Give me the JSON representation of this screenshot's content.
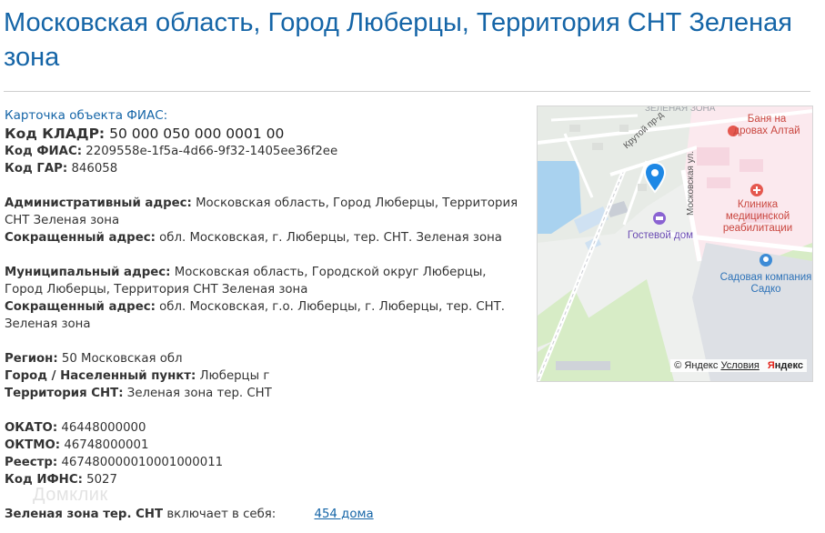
{
  "header": {
    "title": "Московская область, Город Люберцы, Территория СНТ Зеленая зона"
  },
  "card": {
    "link_text": "Карточка объекта ФИАС:",
    "kladr": {
      "label": "Код КЛАДР:",
      "value": "50 000 050 000 0001 00"
    },
    "fias": {
      "label": "Код ФИАС:",
      "value": "2209558e-1f5a-4d66-9f32-1405ee36f2ee"
    },
    "gar": {
      "label": "Код ГАР:",
      "value": "846058"
    }
  },
  "addresses": {
    "admin": {
      "label": "Административный адрес:",
      "value": "Московская область, Город Люберцы, Территория СНТ Зеленая зона"
    },
    "admin_short": {
      "label": "Сокращенный адрес:",
      "value": "обл. Московская, г. Люберцы, тер. СНТ. Зеленая зона"
    },
    "municipal": {
      "label": "Муниципальный адрес:",
      "value": "Московская область, Городской округ Люберцы, Город Люберцы, Территория СНТ Зеленая зона"
    },
    "municipal_short": {
      "label": "Сокращенный адрес:",
      "value": "обл. Московская, г.о. Люберцы, г. Люберцы, тер. СНТ. Зеленая зона"
    }
  },
  "location": {
    "region": {
      "label": "Регион:",
      "value": "50 Московская обл"
    },
    "city": {
      "label": "Город / Населенный пункт:",
      "value": "Люберцы г"
    },
    "territory": {
      "label": "Территория СНТ:",
      "value": "Зеленая зона тер. СНТ"
    }
  },
  "codes": {
    "okato": {
      "label": "ОКАТО:",
      "value": "46448000000"
    },
    "oktmo": {
      "label": "ОКТМО:",
      "value": "46748000001"
    },
    "registry": {
      "label": "Реестр:",
      "value": "467480000010001000011"
    },
    "ifns": {
      "label": "Код ИФНС:",
      "value": "5027"
    }
  },
  "footer": {
    "bold": "Зеленая зона тер. СНТ",
    "text": "включает в себя:",
    "link": "454 дома"
  },
  "watermark": "Домклик",
  "map": {
    "labels": {
      "area": "ЗЕЛЕНАЯ ЗОНА",
      "banya": "Баня на дровах Алтай",
      "clinic": "Клиника медицинской реабилитации",
      "guest": "Гостевой дом",
      "garden": "Садовая компания Садко",
      "street1": "Крутой пр-д",
      "street2": "Московская ул."
    },
    "copyright": "© Яндекс",
    "terms": "Условия",
    "brand": "Яндекс",
    "colors": {
      "pin": "#1e88e5",
      "poi_red": "#e5584f",
      "poi_purple": "#8a63d2",
      "poi_blue": "#3d8bd6"
    }
  }
}
